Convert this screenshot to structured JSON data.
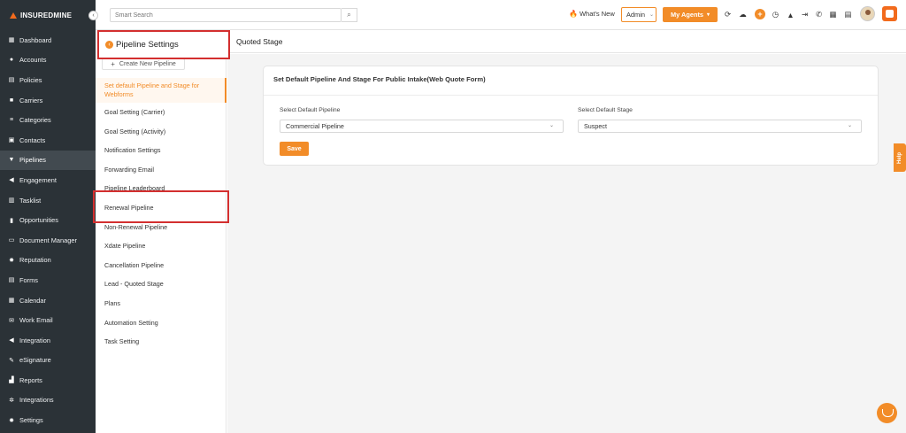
{
  "app": {
    "logo_text": "INSUREDMINE",
    "collapse_icon": "chevron-left-icon"
  },
  "topbar": {
    "search_placeholder": "Smart Search",
    "whats_new": "What's New",
    "admin_label": "Admin",
    "agents_label": "My Agents",
    "icons": [
      "sync-icon",
      "cloud-icon",
      "plus-icon",
      "clock-icon",
      "bell-icon",
      "logout-icon",
      "phone-icon",
      "grid-icon",
      "calculator-icon"
    ]
  },
  "sidebar": {
    "items": [
      {
        "label": "Dashboard",
        "icon": "dashboard-icon"
      },
      {
        "label": "Accounts",
        "icon": "accounts-icon"
      },
      {
        "label": "Policies",
        "icon": "policies-icon"
      },
      {
        "label": "Carriers",
        "icon": "carriers-icon"
      },
      {
        "label": "Categories",
        "icon": "categories-icon"
      },
      {
        "label": "Contacts",
        "icon": "contacts-icon"
      },
      {
        "label": "Pipelines",
        "icon": "funnel-icon",
        "active": true
      },
      {
        "label": "Engagement",
        "icon": "megaphone-icon"
      },
      {
        "label": "Tasklist",
        "icon": "tasklist-icon"
      },
      {
        "label": "Opportunities",
        "icon": "chart-icon"
      },
      {
        "label": "Document Manager",
        "icon": "folder-icon"
      },
      {
        "label": "Reputation",
        "icon": "reputation-icon"
      },
      {
        "label": "Forms",
        "icon": "forms-icon"
      },
      {
        "label": "Calendar",
        "icon": "calendar-icon"
      },
      {
        "label": "Work Email",
        "icon": "email-icon"
      },
      {
        "label": "Integration",
        "icon": "integration-icon"
      },
      {
        "label": "eSignature",
        "icon": "signature-icon"
      },
      {
        "label": "Reports",
        "icon": "reports-icon"
      },
      {
        "label": "Integrations",
        "icon": "gears-icon"
      },
      {
        "label": "Settings",
        "icon": "gear-icon"
      }
    ]
  },
  "settings_panel": {
    "title": "Pipeline Settings",
    "create_label": "Create New Pipeline",
    "active_item_line1": "Set default Pipeline and Stage for",
    "active_item_line2": "Webforms",
    "items": [
      "Goal Setting (Carrier)",
      "Goal Setting (Activity)",
      "Notification Settings",
      "Forwarding Email",
      "Pipeline Leaderboard",
      "Renewal Pipeline",
      "Non-Renewal Pipeline",
      "Xdate Pipeline",
      "Cancellation Pipeline",
      "Lead - Quoted Stage",
      "Plans",
      "Automation Setting",
      "Task Setting"
    ]
  },
  "content": {
    "header_title": "Quoted Stage",
    "card_title": "Set Default Pipeline And Stage For Public Intake(Web Quote Form)",
    "pipeline_label": "Select Default Pipeline",
    "pipeline_value": "Commercial Pipeline",
    "stage_label": "Select Default Stage",
    "stage_value": "Suspect",
    "save_label": "Save"
  },
  "widgets": {
    "help_label": "Help"
  },
  "colors": {
    "accent": "#f28c28",
    "sidebar_bg": "#2b3237",
    "highlight_border": "#d32f2f"
  }
}
